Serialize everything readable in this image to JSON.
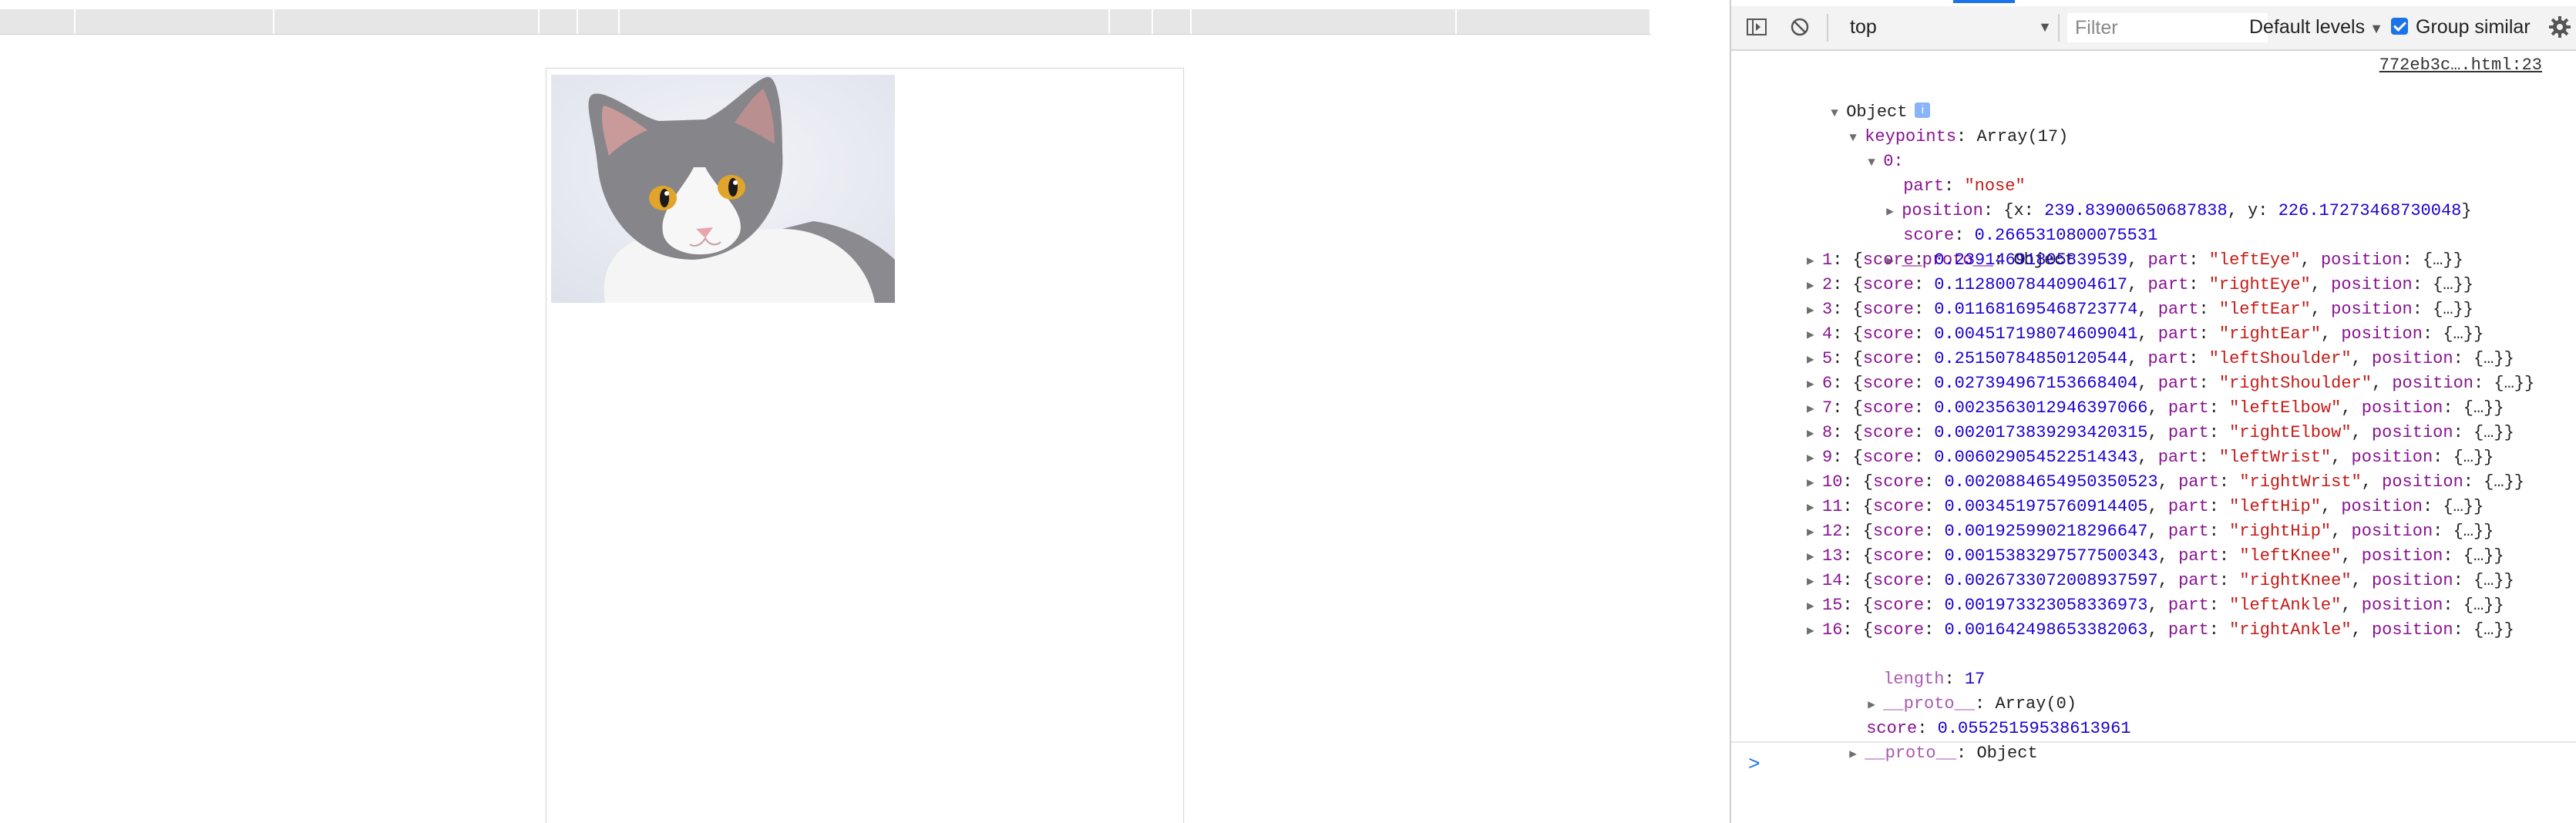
{
  "devtools": {
    "context": "top",
    "filter_placeholder": "Filter",
    "levels_label": "Default levels",
    "group_similar_label": "Group similar",
    "group_similar_checked": true,
    "source_link": "772eb3c….html:23",
    "prompt_symbol": ">"
  },
  "console": {
    "object_label": "Object",
    "info_badge": "i",
    "keypoints_key": "keypoints",
    "keypoints_summary": "Array(17)",
    "item0": {
      "index_label": "0:",
      "part_key": "part",
      "part_value": "\"nose\"",
      "position_key": "position",
      "position_summary_prefix": "{x: ",
      "position_x": "239.83900650687838",
      "position_mid": ", y: ",
      "position_y": "226.17273468730048",
      "position_summary_suffix": "}",
      "score_key": "score",
      "score_value": "0.2665310800075531",
      "proto_key": "__proto__",
      "proto_value": "Object"
    },
    "items": [
      {
        "idx": "1",
        "score": "0.23914691805839539",
        "part": "\"leftEye\""
      },
      {
        "idx": "2",
        "score": "0.11280078440904617",
        "part": "\"rightEye\""
      },
      {
        "idx": "3",
        "score": "0.011681695468723774",
        "part": "\"leftEar\""
      },
      {
        "idx": "4",
        "score": "0.004517198074609041",
        "part": "\"rightEar\""
      },
      {
        "idx": "5",
        "score": "0.25150784850120544",
        "part": "\"leftShoulder\""
      },
      {
        "idx": "6",
        "score": "0.027394967153668404",
        "part": "\"rightShoulder\""
      },
      {
        "idx": "7",
        "score": "0.0023563012946397066",
        "part": "\"leftElbow\""
      },
      {
        "idx": "8",
        "score": "0.0020173839293420315",
        "part": "\"rightElbow\""
      },
      {
        "idx": "9",
        "score": "0.006029054522514343",
        "part": "\"leftWrist\""
      },
      {
        "idx": "10",
        "score": "0.0020884654950350523",
        "part": "\"rightWrist\""
      },
      {
        "idx": "11",
        "score": "0.003451975760914405",
        "part": "\"leftHip\""
      },
      {
        "idx": "12",
        "score": "0.001925990218296647",
        "part": "\"rightHip\""
      },
      {
        "idx": "13",
        "score": "0.0015383297577500343",
        "part": "\"leftKnee\""
      },
      {
        "idx": "14",
        "score": "0.0026733072008937597",
        "part": "\"rightKnee\""
      },
      {
        "idx": "15",
        "score": "0.001973323058336973",
        "part": "\"leftAnkle\""
      },
      {
        "idx": "16",
        "score": "0.001642498653382063",
        "part": "\"rightAnkle\""
      }
    ],
    "length_key": "length",
    "length_value": "17",
    "array_proto_key": "__proto__",
    "array_proto_value": "Array(0)",
    "score_key": "score",
    "score_value": "0.05525159538613961",
    "object_proto_key": "__proto__",
    "object_proto_value": "Object"
  }
}
